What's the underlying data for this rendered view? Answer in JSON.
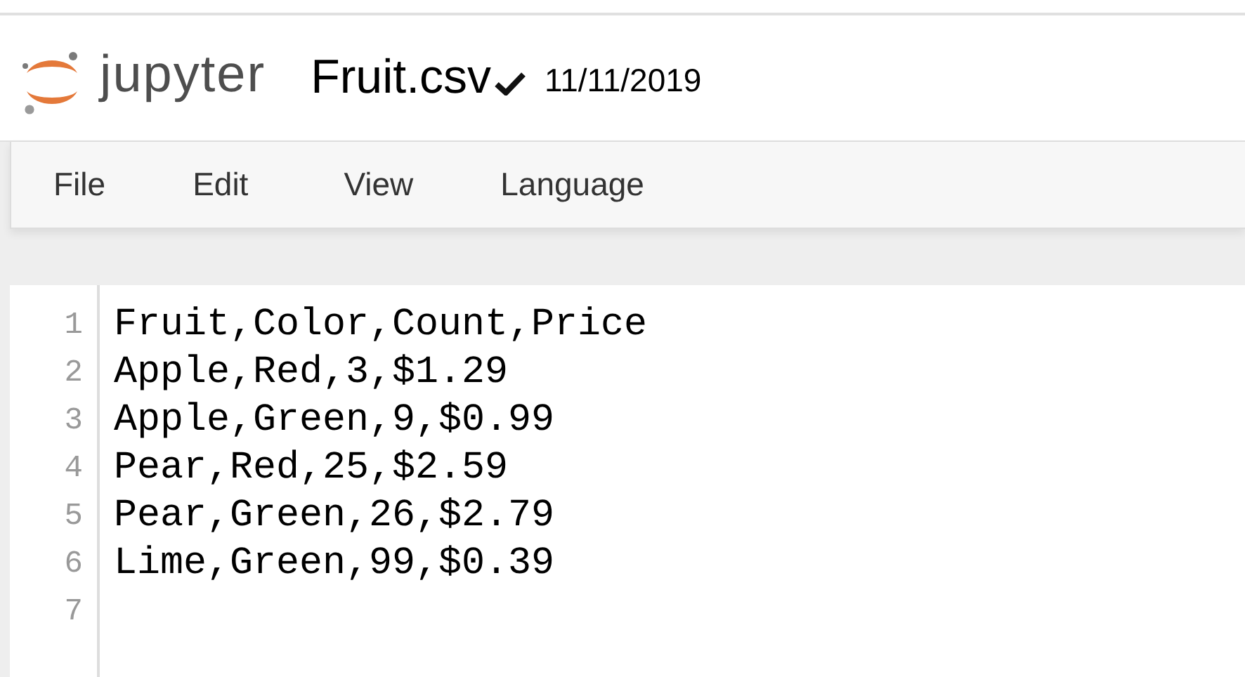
{
  "header": {
    "logo_text": "jupyter",
    "file_name": "Fruit.csv",
    "saved": true,
    "date": "11/11/2019"
  },
  "menu": [
    "File",
    "Edit",
    "View",
    "Language"
  ],
  "editor": {
    "lines": [
      {
        "number": "1",
        "text": "Fruit,Color,Count,Price"
      },
      {
        "number": "2",
        "text": "Apple,Red,3,$1.29"
      },
      {
        "number": "3",
        "text": "Apple,Green,9,$0.99"
      },
      {
        "number": "4",
        "text": "Pear,Red,25,$2.59"
      },
      {
        "number": "5",
        "text": "Pear,Green,26,$2.79"
      },
      {
        "number": "6",
        "text": "Lime,Green,99,$0.39"
      },
      {
        "number": "7"
      }
    ]
  }
}
